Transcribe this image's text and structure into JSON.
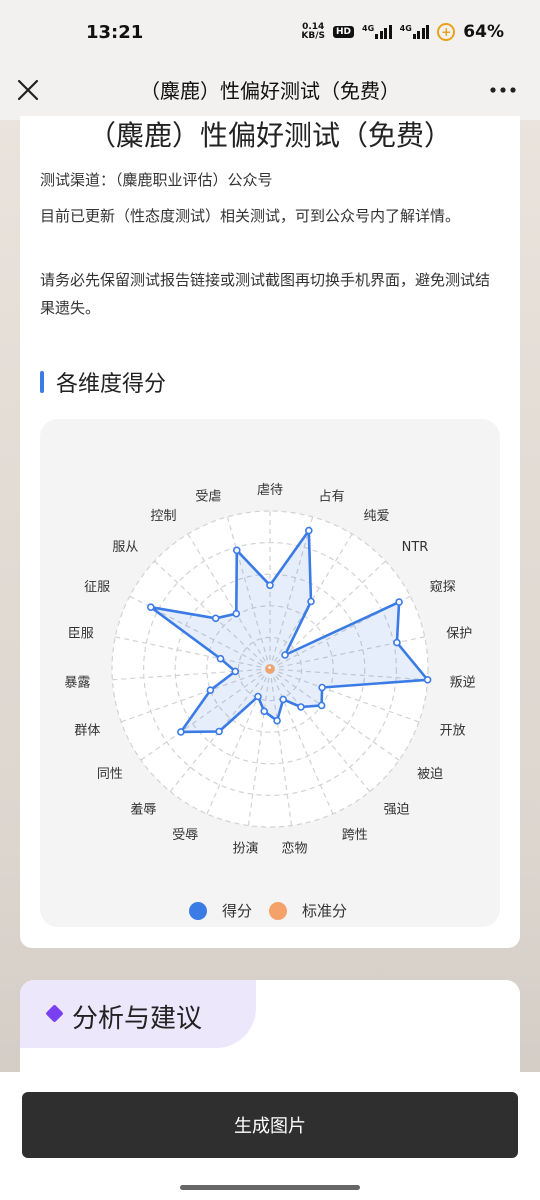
{
  "status": {
    "time": "13:21",
    "net_speed_value": "0.14",
    "net_speed_unit": "KB/S",
    "hd": "HD",
    "sig1_tag": "4G",
    "sig2_tag": "4G",
    "battery_text": "64%"
  },
  "nav": {
    "title": "（麋鹿）性偏好测试（免费）"
  },
  "card": {
    "title": "（麋鹿）性偏好测试（免费）",
    "channel": "测试渠道：（麋鹿职业评估）公众号",
    "update_note": "目前已更新（性态度测试）相关测试，可到公众号内了解详情。",
    "warning": "请务必先保留测试报告链接或测试截图再切换手机界面，避免测试结果遗失。",
    "section_title": "各维度得分"
  },
  "chart_data": {
    "type": "radar",
    "categories": [
      "虐待",
      "占有",
      "纯爱",
      "NTR",
      "窥探",
      "保护",
      "叛逆",
      "开放",
      "被迫",
      "强迫",
      "跨性",
      "恋物",
      "扮演",
      "受辱",
      "羞辱",
      "同性",
      "群体",
      "暴露",
      "臣服",
      "征服",
      "服从",
      "控制",
      "受虐"
    ],
    "series": [
      {
        "name": "得分",
        "color": "#3b7be6",
        "values": [
          0.53,
          0.91,
          0.5,
          0.13,
          0.92,
          0.82,
          1.0,
          0.35,
          0.4,
          0.31,
          0.21,
          0.33,
          0.27,
          0.19,
          0.51,
          0.69,
          0.4,
          0.22,
          0.32,
          0.85,
          0.47,
          0.41,
          0.78
        ]
      },
      {
        "name": "标准分",
        "color": "#f4a26a",
        "values": [
          0.01,
          0.01,
          0.01,
          0.01,
          0.01,
          0.01,
          0.01,
          0.01,
          0.01,
          0.01,
          0.01,
          0.01,
          0.01,
          0.01,
          0.01,
          0.01,
          0.01,
          0.01,
          0.01,
          0.01,
          0.01,
          0.01,
          0.01
        ]
      }
    ],
    "legend_position": "bottom",
    "grid": true
  },
  "card2": {
    "title": "分析与建议"
  },
  "bottom": {
    "generate_label": "生成图片"
  }
}
